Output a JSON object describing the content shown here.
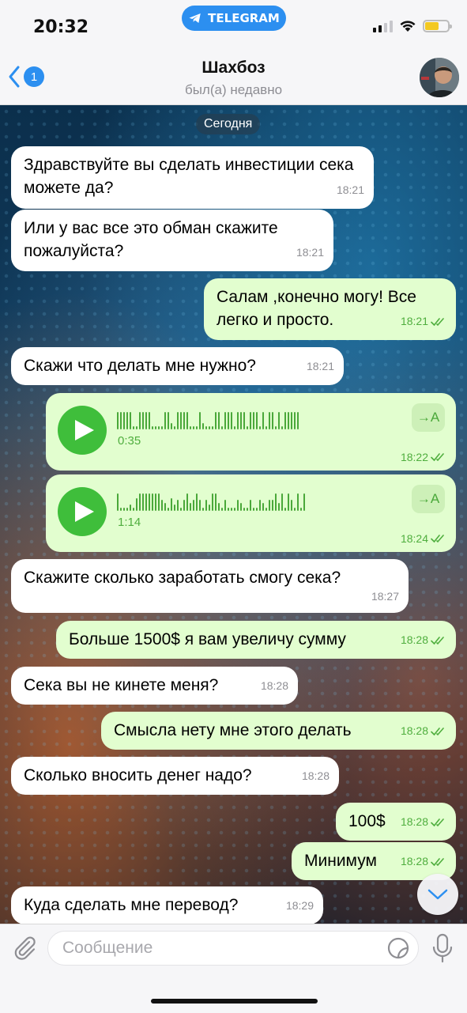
{
  "status_bar": {
    "time": "20:32",
    "app_pill": "TELEGRAM",
    "battery_color": "#f3c922"
  },
  "header": {
    "back_badge": "1",
    "name": "Шахбоз",
    "status": "был(а) недавно"
  },
  "chat": {
    "date_chip": "Сегодня",
    "messages": [
      {
        "dir": "in",
        "text": "Здравствуйте вы сделать инвестиции сека можете да?",
        "time": "18:21"
      },
      {
        "dir": "in",
        "text": "Или у вас все это обман скажите пожалуйста?",
        "time": "18:21"
      },
      {
        "dir": "out",
        "text": "Салам ,конечно могу! Все легко и просто.",
        "time": "18:21"
      },
      {
        "dir": "in",
        "text": "Скажи что делать мне нужно?",
        "time": "18:21"
      },
      {
        "dir": "out",
        "type": "voice",
        "duration": "0:35",
        "time": "18:22",
        "transcribe": "→A"
      },
      {
        "dir": "out",
        "type": "voice",
        "duration": "1:14",
        "time": "18:24",
        "transcribe": "→A"
      },
      {
        "dir": "in",
        "text": "Скажите сколько заработать смогу сека?",
        "time": "18:27"
      },
      {
        "dir": "out",
        "text": "Больше 1500$ я вам увеличу сумму",
        "time": "18:28"
      },
      {
        "dir": "in",
        "text": "Сека вы не кинете меня?",
        "time": "18:28"
      },
      {
        "dir": "out",
        "text": "Смысла нету мне этого делать",
        "time": "18:28"
      },
      {
        "dir": "in",
        "text": "Сколько вносить денег надо?",
        "time": "18:28"
      },
      {
        "dir": "out",
        "text": "100$",
        "time": "18:28"
      },
      {
        "dir": "out",
        "text": "Минимум",
        "time": "18:28"
      },
      {
        "dir": "in",
        "text": "Куда сделать мне перевод?",
        "time": "18:29"
      }
    ]
  },
  "input": {
    "placeholder": "Сообщение"
  },
  "colors": {
    "accent": "#2c8ff0",
    "outgoing_bubble": "#e2fecf",
    "incoming_bubble": "#ffffff",
    "check_green": "#4fae3e"
  }
}
